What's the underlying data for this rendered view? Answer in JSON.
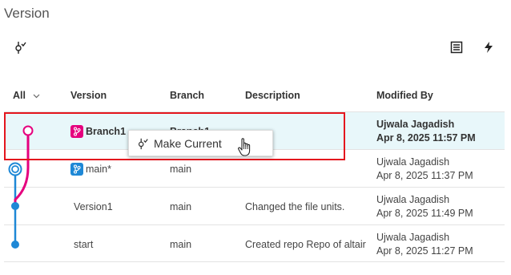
{
  "title": "Version",
  "toolbar": {
    "left_icon": "commit-icon",
    "right_icons": [
      "list-icon",
      "lightning-icon"
    ]
  },
  "columns": {
    "filter": "All",
    "version": "Version",
    "branch": "Branch",
    "description": "Description",
    "modified_by": "Modified By"
  },
  "rows": [
    {
      "version": "Branch1",
      "badge": "branch-icon",
      "badge_color": "#e5007e",
      "branch": "Branch1",
      "description": "",
      "user": "Ujwala Jagadish",
      "date": "Apr 8, 2025 11:57 PM",
      "bold": true
    },
    {
      "version": "main*",
      "badge": "branch-icon",
      "badge_color": "#1e88d6",
      "branch": "main",
      "description": "",
      "user": "Ujwala Jagadish",
      "date": "Apr 8, 2025 11:37 PM",
      "bold": false
    },
    {
      "version": "Version1",
      "badge": "",
      "branch": "main",
      "description": "Changed the file units.",
      "user": "Ujwala Jagadish",
      "date": "Apr 8, 2025 11:49 PM",
      "bold": false
    },
    {
      "version": "start",
      "badge": "",
      "branch": "main",
      "description": "Created repo Repo of altair",
      "user": "Ujwala Jagadish",
      "date": "Apr 8, 2025 11:27 PM",
      "bold": false
    }
  ],
  "context_menu": {
    "item_label": "Make Current",
    "item_icon": "commit-icon"
  },
  "colors": {
    "branch_magenta": "#e5007e",
    "main_blue": "#1e88d6",
    "highlight_red": "#e4161e",
    "selected_row_bg": "#e8f7fa"
  }
}
